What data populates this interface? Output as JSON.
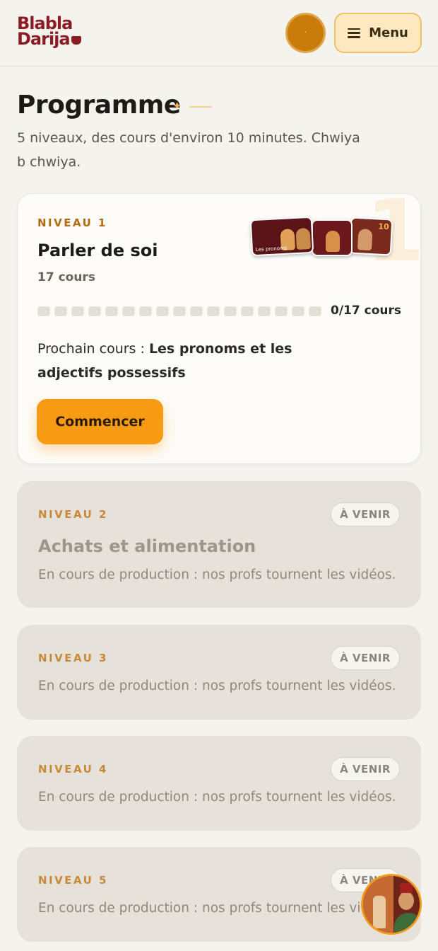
{
  "header": {
    "logo_line1": "Blabla",
    "logo_line2": "Darija",
    "avatar_glyph": "·",
    "menu_label": "Menu"
  },
  "page": {
    "title": "Programme",
    "subtitle": "5 niveaux, des cours d'environ 10 minutes. Chwiya b chwiya."
  },
  "level1": {
    "big_number": "1",
    "label": "NIVEAU 1",
    "title": "Parler de soi",
    "count": "17 cours",
    "progress_done": 0,
    "progress_total": 17,
    "progress_text": "0/17 cours",
    "next_prefix": "Prochain cours : ",
    "next_title": "Les pronoms et les adjectifs possessifs",
    "thumbs": [
      {
        "caption": "Les pronoms"
      },
      {
        "caption": ""
      },
      {
        "caption": "10"
      }
    ],
    "cta": "Commencer"
  },
  "upcoming": [
    {
      "label": "NIVEAU 2",
      "badge": "À VENIR",
      "title": "Achats et alimentation",
      "desc": "En cours de production : nos profs tournent les vidéos."
    },
    {
      "label": "NIVEAU 3",
      "badge": "À VENIR",
      "title": "",
      "desc": "En cours de production : nos profs tournent les vidéos."
    },
    {
      "label": "NIVEAU 4",
      "badge": "À VENIR",
      "title": "",
      "desc": "En cours de production : nos profs tournent les vidéos."
    },
    {
      "label": "NIVEAU 5",
      "badge": "À VENIR",
      "title": "",
      "desc": "En cours de production : nos profs tournent les vidéos."
    }
  ],
  "colors": {
    "accent": "#f79a14",
    "brand": "#8b1c24",
    "level_label": "#b36a0b"
  }
}
